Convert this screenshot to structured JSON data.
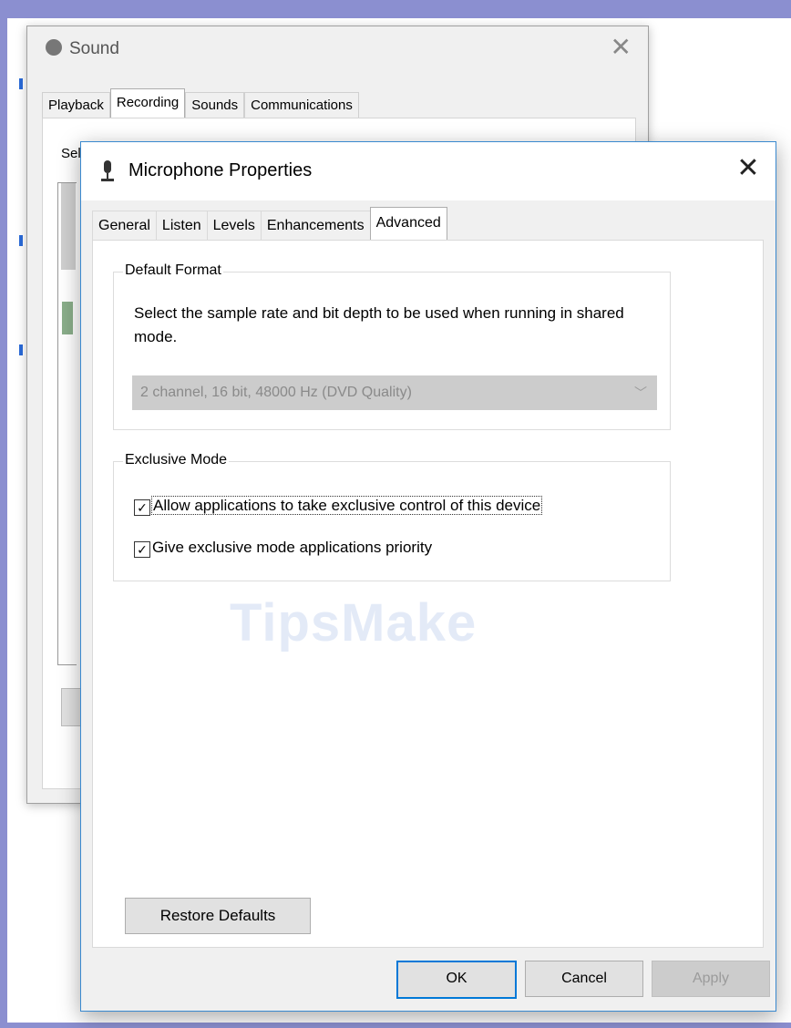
{
  "sound_window": {
    "title": "Sound",
    "close_glyph": "✕",
    "tabs": [
      "Playback",
      "Recording",
      "Sounds",
      "Communications"
    ],
    "active_tab": "Recording",
    "partial_text": "Sel"
  },
  "mic_window": {
    "title": "Microphone Properties",
    "close_glyph": "✕",
    "tabs": [
      "General",
      "Listen",
      "Levels",
      "Enhancements",
      "Advanced"
    ],
    "active_tab": "Advanced",
    "default_format": {
      "label": "Default Format",
      "description": "Select the sample rate and bit depth to be used when running in shared mode.",
      "selected": "2 channel, 16 bit, 48000 Hz (DVD Quality)",
      "enabled": false
    },
    "exclusive_mode": {
      "label": "Exclusive Mode",
      "allow_exclusive": {
        "label": "Allow applications to take exclusive control of this device",
        "checked": true
      },
      "priority": {
        "label": "Give exclusive mode applications priority",
        "checked": true
      }
    },
    "restore_defaults_label": "Restore Defaults",
    "buttons": {
      "ok": "OK",
      "cancel": "Cancel",
      "apply": "Apply"
    },
    "watermark": "TipsMake"
  },
  "icons": {
    "check": "✓",
    "dropdown": "﹀"
  },
  "colors": {
    "accent": "#0078d7",
    "frame": "#8b8fd0",
    "window_border": "#3a89cf"
  }
}
